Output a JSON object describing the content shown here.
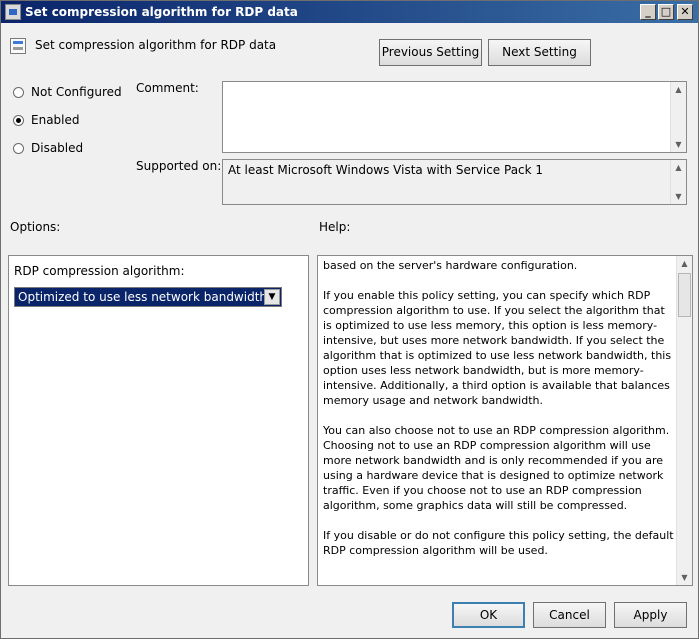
{
  "window": {
    "title": "Set compression algorithm for RDP data",
    "min_glyph": "_",
    "max_glyph": "□",
    "close_glyph": "✕"
  },
  "header": {
    "policy_title": "Set compression algorithm for RDP data",
    "policy_icon": "policy-setting-icon",
    "previous_label": "Previous Setting",
    "next_label": "Next Setting"
  },
  "state": {
    "options": [
      {
        "label": "Not Configured",
        "checked": false
      },
      {
        "label": "Enabled",
        "checked": true
      },
      {
        "label": "Disabled",
        "checked": false
      }
    ]
  },
  "comment": {
    "label": "Comment:",
    "value": ""
  },
  "supported": {
    "label": "Supported on:",
    "value": "At least Microsoft Windows Vista with Service Pack 1"
  },
  "options_section": {
    "label": "Options:",
    "field_label": "RDP compression algorithm:",
    "selected_value": "Optimized to use less network bandwidth"
  },
  "help_section": {
    "label": "Help:",
    "paragraphs": [
      "based on the server's hardware configuration.",
      "If you enable this policy setting, you can specify which RDP compression algorithm to use. If you select the algorithm that is optimized to use less memory, this option is less memory-intensive, but uses more network bandwidth. If you select the algorithm that is optimized to use less network bandwidth, this option uses less network bandwidth, but is more memory-intensive. Additionally, a third option is available that balances memory usage and network bandwidth.",
      "You can also choose not to use an RDP compression algorithm. Choosing not to use an RDP compression algorithm will use more network bandwidth and is only recommended if you are using a hardware device that is designed to optimize network traffic. Even if you choose not to use an RDP compression algorithm, some graphics data will still be compressed.",
      "If you disable or do not configure this policy setting, the default RDP compression algorithm will be used."
    ]
  },
  "footer": {
    "ok_label": "OK",
    "cancel_label": "Cancel",
    "apply_label": "Apply"
  },
  "colors": {
    "title_bar": "#0a246a",
    "selection": "#0a246a",
    "dialog_bg": "#f0f0f0"
  }
}
